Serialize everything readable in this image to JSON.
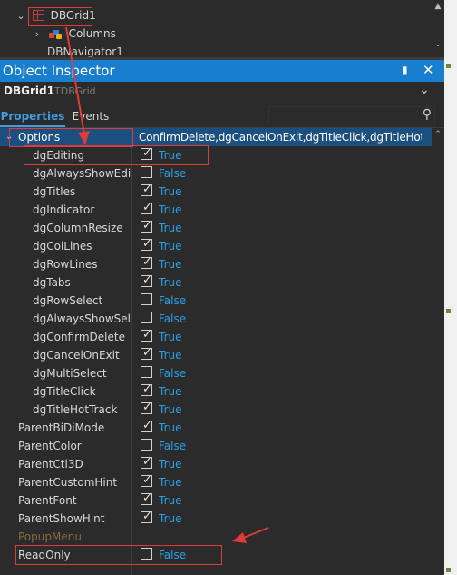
{
  "tree": {
    "nodes": [
      {
        "label": "DBGrid1",
        "expanded": true
      },
      {
        "label": "Columns",
        "expanded": false
      },
      {
        "label": "DBNavigator1"
      }
    ]
  },
  "inspector": {
    "title": "Object Inspector",
    "pin_icon": "pin-icon",
    "close_icon": "close-icon",
    "component_name": "DBGrid1",
    "component_type": "TDBGrid",
    "tabs": [
      "Properties",
      "Events"
    ],
    "search_placeholder": "",
    "colors": {
      "accent": "#1a7ecf",
      "value_blue": "#2aa0e8",
      "selection": "#1b4f7f",
      "annotation": "#e03a3a"
    }
  },
  "options_row": {
    "name": "Options",
    "value": "[dgEditing,dgTitles,dgIndicator,dgColumnResize,dgColLines,dgRowLines,dgTabs,dgConfirmDelete,dgCancelOnExit,dgTitleClick,dgTitleHotTrack]",
    "visible_value": "ConfirmDelete,dgCancelOnExit,dgTitleClick,dgTitleHotTrac"
  },
  "properties": [
    {
      "name": "dgEditing",
      "checked": true,
      "value": "True"
    },
    {
      "name": "dgAlwaysShowEditor",
      "display": "dgAlwaysShowEdito",
      "checked": false,
      "value": "False"
    },
    {
      "name": "dgTitles",
      "checked": true,
      "value": "True"
    },
    {
      "name": "dgIndicator",
      "checked": true,
      "value": "True"
    },
    {
      "name": "dgColumnResize",
      "checked": true,
      "value": "True"
    },
    {
      "name": "dgColLines",
      "checked": true,
      "value": "True"
    },
    {
      "name": "dgRowLines",
      "checked": true,
      "value": "True"
    },
    {
      "name": "dgTabs",
      "checked": true,
      "value": "True"
    },
    {
      "name": "dgRowSelect",
      "checked": false,
      "value": "False"
    },
    {
      "name": "dgAlwaysShowSelection",
      "display": "dgAlwaysShowSelect",
      "checked": false,
      "value": "False"
    },
    {
      "name": "dgConfirmDelete",
      "checked": true,
      "value": "True"
    },
    {
      "name": "dgCancelOnExit",
      "checked": true,
      "value": "True"
    },
    {
      "name": "dgMultiSelect",
      "checked": false,
      "value": "False"
    },
    {
      "name": "dgTitleClick",
      "checked": true,
      "value": "True"
    },
    {
      "name": "dgTitleHotTrack",
      "checked": true,
      "value": "True"
    },
    {
      "name": "ParentBiDiMode",
      "checked": true,
      "value": "True"
    },
    {
      "name": "ParentColor",
      "checked": false,
      "value": "False"
    },
    {
      "name": "ParentCtl3D",
      "checked": true,
      "value": "True"
    },
    {
      "name": "ParentCustomHint",
      "checked": true,
      "value": "True"
    },
    {
      "name": "ParentFont",
      "checked": true,
      "value": "True"
    },
    {
      "name": "ParentShowHint",
      "checked": true,
      "value": "True"
    },
    {
      "name": "PopupMenu",
      "value": ""
    },
    {
      "name": "ReadOnly",
      "checked": false,
      "value": "False"
    }
  ]
}
